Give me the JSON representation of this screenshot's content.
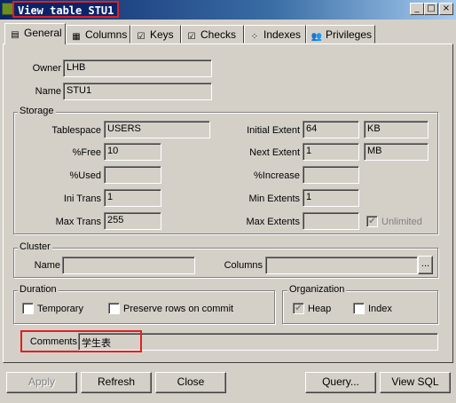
{
  "window": {
    "title": "View table STU1",
    "controls": {
      "minimize": "_",
      "maximize": "□",
      "close": "×"
    }
  },
  "tabs": [
    {
      "label": "General",
      "icon": "general-tab-icon",
      "active": true
    },
    {
      "label": "Columns",
      "icon": "columns-tab-icon",
      "active": false
    },
    {
      "label": "Keys",
      "icon": "keys-tab-icon",
      "active": false
    },
    {
      "label": "Checks",
      "icon": "checks-tab-icon",
      "active": false
    },
    {
      "label": "Indexes",
      "icon": "indexes-tab-icon",
      "active": false
    },
    {
      "label": "Privileges",
      "icon": "privileges-tab-icon",
      "active": false
    }
  ],
  "general": {
    "owner_label": "Owner",
    "owner_value": "LHB",
    "name_label": "Name",
    "name_value": "STU1"
  },
  "storage": {
    "title": "Storage",
    "tablespace_label": "Tablespace",
    "tablespace_value": "USERS",
    "pctfree_label": "%Free",
    "pctfree_value": "10",
    "pctused_label": "%Used",
    "pctused_value": "",
    "initrans_label": "Ini Trans",
    "initrans_value": "1",
    "maxtrans_label": "Max Trans",
    "maxtrans_value": "255",
    "initial_extent_label": "Initial Extent",
    "initial_extent_value": "64",
    "initial_extent_unit": "KB",
    "next_extent_label": "Next Extent",
    "next_extent_value": "1",
    "next_extent_unit": "MB",
    "pctincrease_label": "%Increase",
    "pctincrease_value": "",
    "min_extents_label": "Min Extents",
    "min_extents_value": "1",
    "max_extents_label": "Max Extents",
    "max_extents_value": "",
    "unlimited_label": "Unlimited",
    "unlimited_checked": true
  },
  "cluster": {
    "title": "Cluster",
    "name_label": "Name",
    "name_value": "",
    "columns_label": "Columns",
    "columns_value": "",
    "browse_label": "..."
  },
  "duration": {
    "title": "Duration",
    "temporary_label": "Temporary",
    "temporary_checked": false,
    "preserve_label": "Preserve rows on commit",
    "preserve_checked": false
  },
  "organization": {
    "title": "Organization",
    "heap_label": "Heap",
    "heap_checked": true,
    "index_label": "Index",
    "index_checked": false
  },
  "comments": {
    "label": "Comments",
    "value": "学生表"
  },
  "buttons": {
    "apply": "Apply",
    "refresh": "Refresh",
    "close": "Close",
    "query": "Query...",
    "view_sql": "View SQL"
  }
}
